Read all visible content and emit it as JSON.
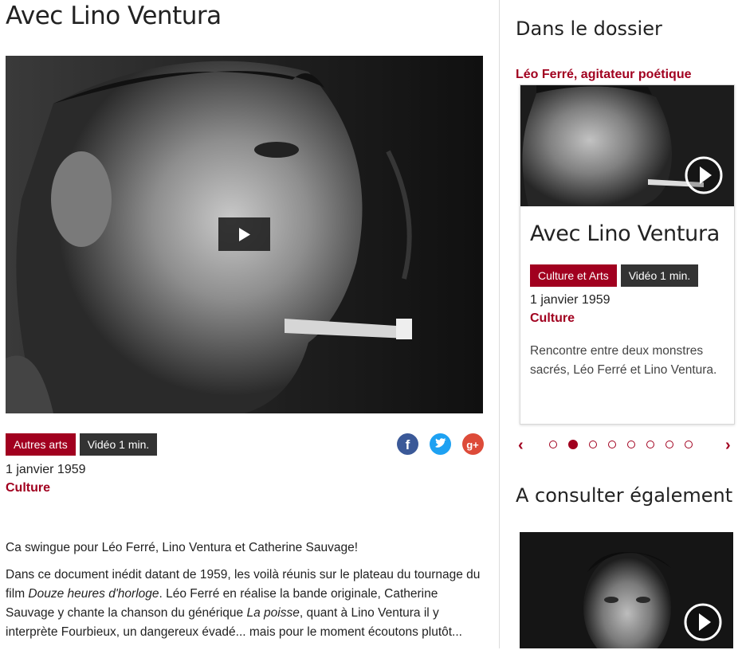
{
  "main": {
    "title": "Avec Lino Ventura",
    "tags": [
      {
        "label": "Autres arts",
        "color": "#a1001f"
      },
      {
        "label": "Vidéo 1 min.",
        "color": "#333333"
      }
    ],
    "date": "1 janvier 1959",
    "category": "Culture",
    "social": [
      {
        "icon": "facebook-icon",
        "letter": "f",
        "color": "#3b5998"
      },
      {
        "icon": "twitter-icon",
        "color": "#1da1f2"
      },
      {
        "icon": "google-plus-icon",
        "letter": "g+",
        "color": "#dd4b39"
      }
    ],
    "description": {
      "intro": "Ca swingue pour Léo Ferré, Lino Ventura et Catherine Sauvage!",
      "p2_a": "Dans ce document inédit datant de 1959, les voilà réunis sur le plateau du tournage du film ",
      "p2_film": "Douze heures d'horloge",
      "p2_b": ". Léo Ferré en réalise la bande originale, Catherine Sauvage y chante la chanson du générique ",
      "p2_song": "La poisse",
      "p2_c": ", quant à Lino Ventura il y interprète Fourbieux, un dangereux évadé... mais pour le moment écoutons plutôt..."
    }
  },
  "sidebar": {
    "dossier_heading": "Dans le dossier",
    "dossier_link": "Léo Ferré, agitateur poétique",
    "card": {
      "title": "Avec Lino Ventura",
      "tags": [
        {
          "label": "Culture et Arts",
          "color": "#a1001f"
        },
        {
          "label": "Vidéo 1 min.",
          "color": "#333333"
        }
      ],
      "date": "1 janvier 1959",
      "category": "Culture",
      "description": "Rencontre entre deux monstres sacrés, Léo Ferré et Lino Ventura."
    },
    "carousel": {
      "prev": "‹",
      "next": "›",
      "dot_count": 8,
      "active_index": 1
    },
    "also_heading": "A consulter également"
  },
  "colors": {
    "accent": "#a1001f",
    "dark_tag": "#333333"
  }
}
